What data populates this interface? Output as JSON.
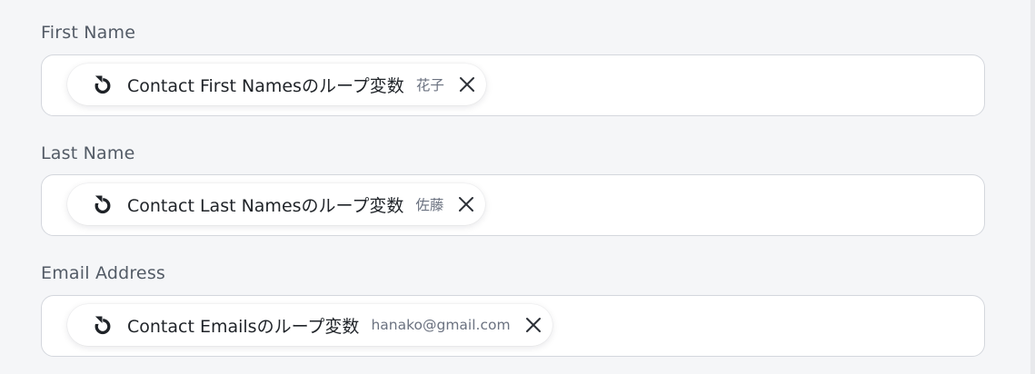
{
  "fields": [
    {
      "label": "First Name",
      "chip": {
        "icon": "loop-icon",
        "label": "Contact First Namesのループ変数",
        "value": "花子"
      }
    },
    {
      "label": "Last Name",
      "chip": {
        "icon": "loop-icon",
        "label": "Contact Last Namesのループ変数",
        "value": "佐藤"
      }
    },
    {
      "label": "Email Address",
      "chip": {
        "icon": "loop-icon",
        "label": "Contact Emailsのループ変数",
        "value": "hanako@gmail.com"
      }
    }
  ],
  "colors": {
    "background": "#f5f6f8",
    "field_border": "#d4d7dd",
    "label_text": "#535b66",
    "chip_text": "#1f2328",
    "chip_value_text": "#6b7280"
  }
}
